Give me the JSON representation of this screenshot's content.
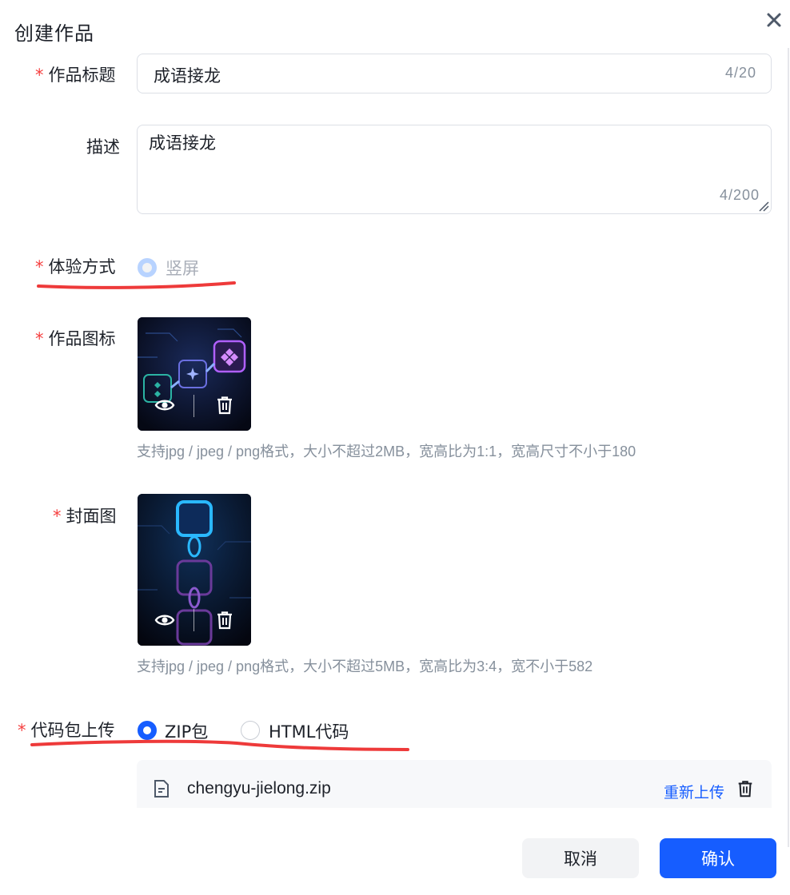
{
  "dialog": {
    "title": "创建作品",
    "close_icon": "close-icon"
  },
  "form": {
    "required_mark": "*",
    "title_field": {
      "label": "作品标题",
      "value": "成语接龙",
      "count": "4/20"
    },
    "description_field": {
      "label": "描述",
      "value": "成语接龙",
      "count": "4/200"
    },
    "experience_field": {
      "label": "体验方式",
      "option": "竖屏",
      "state": "selected-disabled"
    },
    "icon_field": {
      "label": "作品图标",
      "hint": "支持jpg / jpeg / png格式，大小不超过2MB，宽高比为1:1，宽高尺寸不小于180",
      "actions": [
        "eye-icon",
        "trash-icon"
      ]
    },
    "cover_field": {
      "label": "封面图",
      "hint": "支持jpg / jpeg / png格式，大小不超过5MB，宽高比为3:4，宽不小于582",
      "actions": [
        "eye-icon",
        "trash-icon"
      ]
    },
    "code_field": {
      "label": "代码包上传",
      "options": [
        {
          "label": "ZIP包",
          "checked": true
        },
        {
          "label": "HTML代码",
          "checked": false
        }
      ],
      "file": {
        "name": "chengyu-jielong.zip",
        "reupload_label": "重新上传",
        "icon": "file-icon"
      }
    }
  },
  "footer": {
    "cancel_label": "取消",
    "confirm_label": "确认"
  },
  "colors": {
    "primary": "#165dff",
    "required": "#f53f3f",
    "annotation": "#ee3a3a",
    "hint": "#86909c"
  }
}
